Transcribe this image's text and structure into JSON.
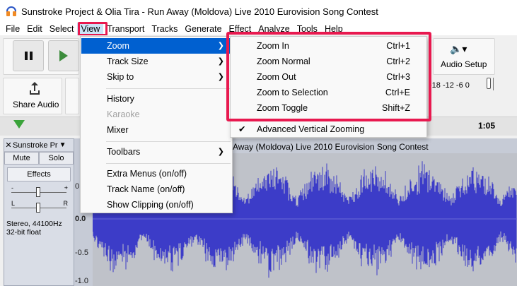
{
  "window": {
    "title": "Sunstroke Project & Olia Tira - Run Away (Moldova) Live 2010 Eurovision Song Contest"
  },
  "menubar": {
    "items": [
      "File",
      "Edit",
      "Select",
      "View",
      "Transport",
      "Tracks",
      "Generate",
      "Effect",
      "Analyze",
      "Tools",
      "Help"
    ],
    "active": "View"
  },
  "toolbar": {
    "pause_icon": "pause-icon",
    "play_icon": "play-icon",
    "share_audio_label": "Share Audio",
    "audio_setup_label": "Audio Setup",
    "meter_ticks": "-18  -12  -6   0"
  },
  "ruler": {
    "time_label": "1:05"
  },
  "track": {
    "name": "Sunstroke Pr",
    "mute_label": "Mute",
    "solo_label": "Solo",
    "effects_label": "Effects",
    "gain_minus": "-",
    "gain_plus": "+",
    "pan_left": "L",
    "pan_right": "R",
    "info_line1": "Stereo, 44100Hz",
    "info_line2": "32-bit float",
    "title_visible": "Away (Moldova) Live 2010 Eurovision Song Contest",
    "y_labels": [
      "0.5",
      "0.0",
      "-0.5",
      "-1.0"
    ]
  },
  "view_menu": {
    "items": [
      {
        "label": "Zoom",
        "submenu": true,
        "active": true
      },
      {
        "label": "Track Size",
        "submenu": true
      },
      {
        "label": "Skip to",
        "submenu": true
      },
      {
        "label": "History"
      },
      {
        "label": "Karaoke",
        "disabled": true
      },
      {
        "label": "Mixer"
      },
      {
        "label": "Toolbars",
        "submenu": true
      },
      {
        "label": "Extra Menus (on/off)"
      },
      {
        "label": "Track Name (on/off)"
      },
      {
        "label": "Show Clipping (on/off)"
      }
    ]
  },
  "zoom_menu": {
    "items": [
      {
        "label": "Zoom In",
        "shortcut": "Ctrl+1"
      },
      {
        "label": "Zoom Normal",
        "shortcut": "Ctrl+2"
      },
      {
        "label": "Zoom Out",
        "shortcut": "Ctrl+3"
      },
      {
        "label": "Zoom to Selection",
        "shortcut": "Ctrl+E"
      },
      {
        "label": "Zoom Toggle",
        "shortcut": "Shift+Z"
      },
      {
        "label": "Advanced Vertical Zooming",
        "checked": true
      }
    ]
  },
  "colors": {
    "highlight": "#e8194f",
    "menu_active": "#0060d0",
    "waveform": "#3c3cc8"
  }
}
